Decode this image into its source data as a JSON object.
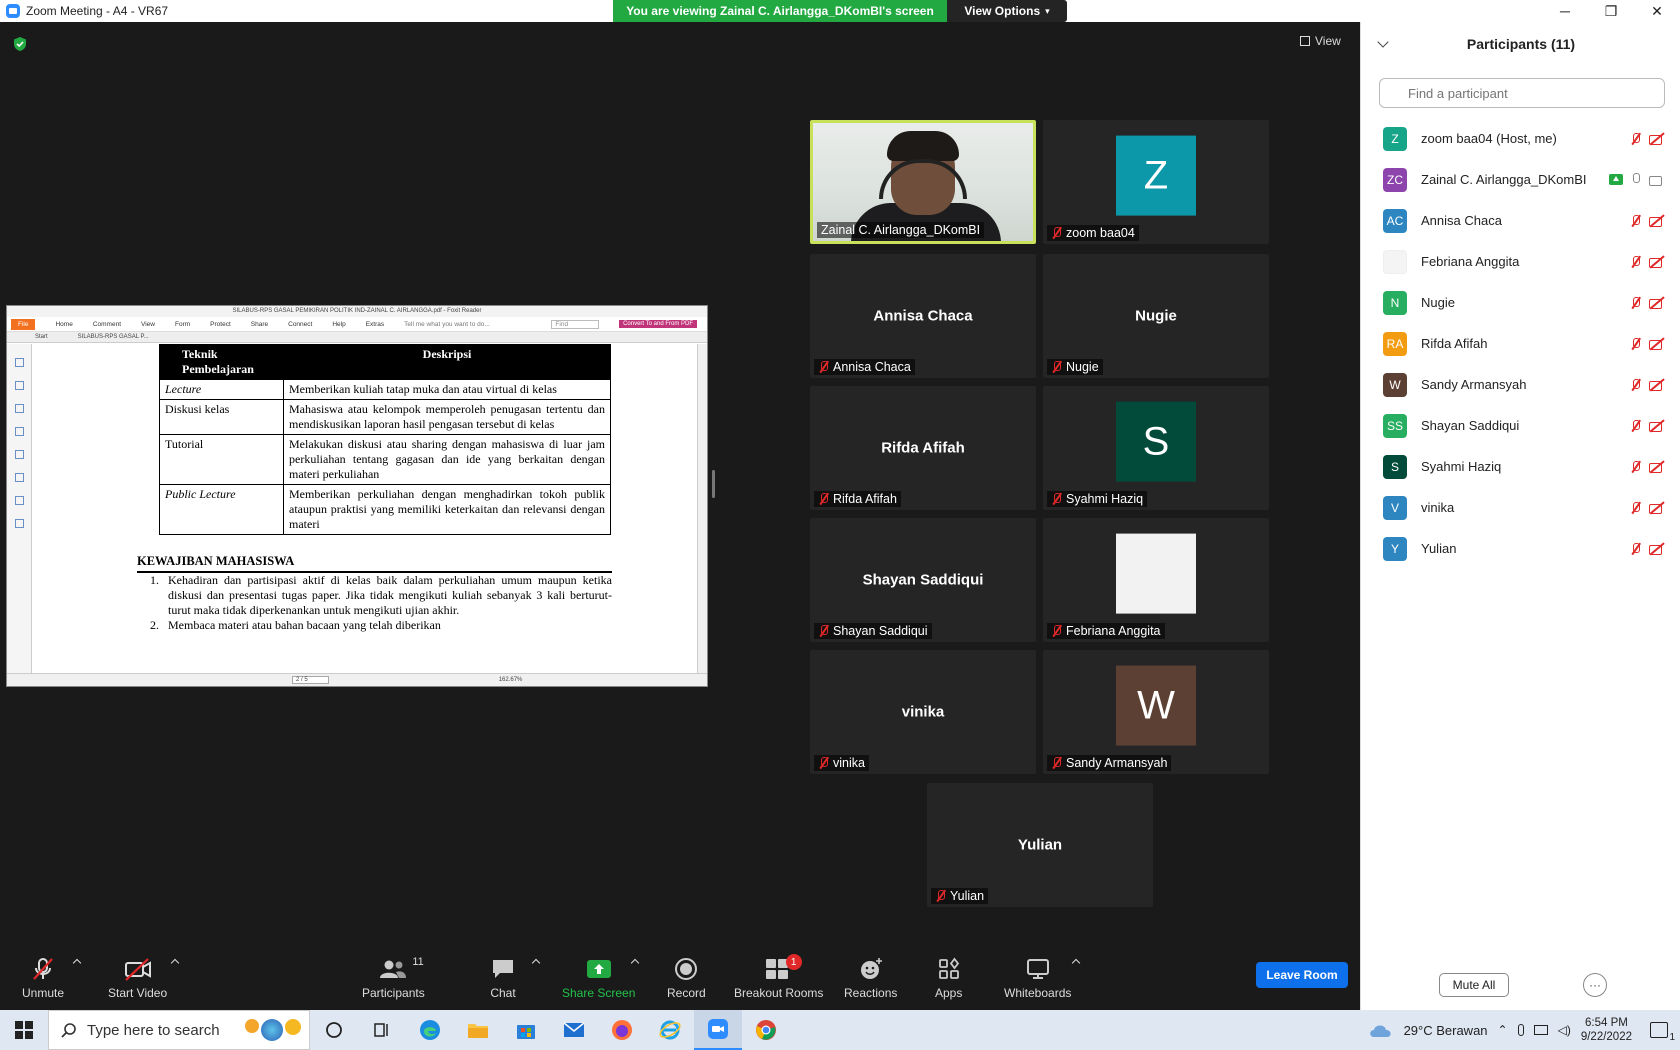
{
  "window": {
    "title": "Zoom Meeting - A4 - VR67",
    "minimize": "─",
    "maximize": "❐",
    "close": "✕"
  },
  "banner": {
    "text": "You are viewing Zainal C. Airlangga_DKomBI's screen",
    "view_options": "View Options"
  },
  "view_button": "View",
  "shared_doc": {
    "title": "SILABUS-RPS GASAL PEMIKIRAN POLITIK IND-ZAINAL C. AIRLANGGA.pdf - Foxit Reader",
    "ribbon": [
      "File",
      "Home",
      "Comment",
      "View",
      "Form",
      "Protect",
      "Share",
      "Connect",
      "Help",
      "Extras",
      "Tell me what you want to do..."
    ],
    "find_placeholder": "Find",
    "tabs": [
      "Start",
      "SILABUS-RPS GASAL P..."
    ],
    "convert": "Convert To and From PDF",
    "page": "2 / 5",
    "zoom": "162.67%",
    "table_header": [
      "Teknik Pembelajaran",
      "Deskripsi"
    ],
    "rows": [
      {
        "term": "Lecture",
        "italic": true,
        "desc": "Memberikan kuliah tatap muka dan atau virtual di kelas"
      },
      {
        "term": "Diskusi kelas",
        "italic": false,
        "desc": "Mahasiswa atau kelompok memperoleh penugasan tertentu dan mendiskusikan laporan hasil pengasan tersebut di kelas"
      },
      {
        "term": "Tutorial",
        "italic": false,
        "desc": "Melakukan diskusi atau sharing dengan mahasiswa di luar jam perkuliahan tentang gagasan dan ide yang berkaitan dengan materi perkuliahan"
      },
      {
        "term": "Public Lecture",
        "italic": true,
        "desc": "Memberikan perkuliahan dengan menghadirkan tokoh publik ataupun praktisi yang memiliki keterkaitan dan relevansi dengan materi"
      }
    ],
    "section_title": "KEWAJIBAN MAHASISWA",
    "item1_num": "1.",
    "item1": "Kehadiran dan partisipasi aktif di kelas baik dalam perkuliahan umum maupun ketika diskusi dan presentasi tugas paper. Jika tidak mengikuti kuliah sebanyak 3 kali berturut-turut maka tidak diperkenankan untuk mengikuti ujian akhir.",
    "item2_num": "2.",
    "item2": "Membaca materi atau bahan bacaan yang telah diberikan"
  },
  "tiles": [
    {
      "label": "Zainal C. Airlangga_DKomBI",
      "center": "",
      "avatar": "",
      "avatar_color": "",
      "video": true
    },
    {
      "label": "zoom baa04",
      "center": "",
      "avatar": "Z",
      "avatar_color": "#0c98a8",
      "video": false
    },
    {
      "label": "Annisa Chaca",
      "center": "Annisa Chaca",
      "avatar": "",
      "avatar_color": "",
      "video": false
    },
    {
      "label": "Nugie",
      "center": "Nugie",
      "avatar": "",
      "avatar_color": "",
      "video": false
    },
    {
      "label": "Rifda Afifah",
      "center": "Rifda Afifah",
      "avatar": "",
      "avatar_color": "",
      "video": false
    },
    {
      "label": "Syahmi Haziq",
      "center": "",
      "avatar": "S",
      "avatar_color": "#024b3a",
      "video": false
    },
    {
      "label": "Shayan Saddiqui",
      "center": "Shayan Saddiqui",
      "avatar": "",
      "avatar_color": "",
      "video": false
    },
    {
      "label": "Febriana Anggita",
      "center": "",
      "avatar": "",
      "avatar_color": "#f2f2f2",
      "video": false
    },
    {
      "label": "vinika",
      "center": "vinika",
      "avatar": "",
      "avatar_color": "",
      "video": false
    },
    {
      "label": "Sandy Armansyah",
      "center": "",
      "avatar": "W",
      "avatar_color": "#5d4034",
      "video": false
    },
    {
      "label": "Yulian",
      "center": "Yulian",
      "avatar": "",
      "avatar_color": "",
      "video": false
    }
  ],
  "panel": {
    "title": "Participants (11)",
    "search_placeholder": "Find a participant",
    "participants": [
      {
        "initials": "Z",
        "color": "#17a589",
        "name": "zoom baa04 (Host, me)",
        "muted": true
      },
      {
        "initials": "ZC",
        "color": "#8e44ad",
        "name": "Zainal C. Airlangga_DKomBI",
        "muted": false
      },
      {
        "initials": "AC",
        "color": "#2e86c1",
        "name": "Annisa Chaca",
        "muted": true
      },
      {
        "initials": "",
        "color": "#f4f4f4",
        "name": "Febriana Anggita",
        "muted": true
      },
      {
        "initials": "N",
        "color": "#27ae60",
        "name": "Nugie",
        "muted": true
      },
      {
        "initials": "RA",
        "color": "#f39c12",
        "name": "Rifda Afifah",
        "muted": true
      },
      {
        "initials": "W",
        "color": "#5d4034",
        "name": "Sandy Armansyah",
        "muted": true
      },
      {
        "initials": "SS",
        "color": "#27ae60",
        "name": "Shayan Saddiqui",
        "muted": true
      },
      {
        "initials": "S",
        "color": "#024b3a",
        "name": "Syahmi Haziq",
        "muted": true
      },
      {
        "initials": "V",
        "color": "#2e86c1",
        "name": "vinika",
        "muted": true
      },
      {
        "initials": "Y",
        "color": "#2e86c1",
        "name": "Yulian",
        "muted": true
      }
    ],
    "mute_all": "Mute All",
    "more": "···"
  },
  "toolbar": {
    "unmute": "Unmute",
    "start_video": "Start Video",
    "participants": "Participants",
    "participant_count": "11",
    "chat": "Chat",
    "share_screen": "Share Screen",
    "record": "Record",
    "breakout": "Breakout Rooms",
    "breakout_badge": "1",
    "reactions": "Reactions",
    "apps": "Apps",
    "whiteboards": "Whiteboards",
    "leave": "Leave Room"
  },
  "taskbar": {
    "search_placeholder": "Type here to search",
    "weather": "29°C  Berawan",
    "time": "6:54 PM",
    "date": "9/22/2022",
    "notifications": "1"
  },
  "colors": {
    "accent": "#0e71eb",
    "share_green": "#23a942",
    "muted_red": "#e02828"
  }
}
